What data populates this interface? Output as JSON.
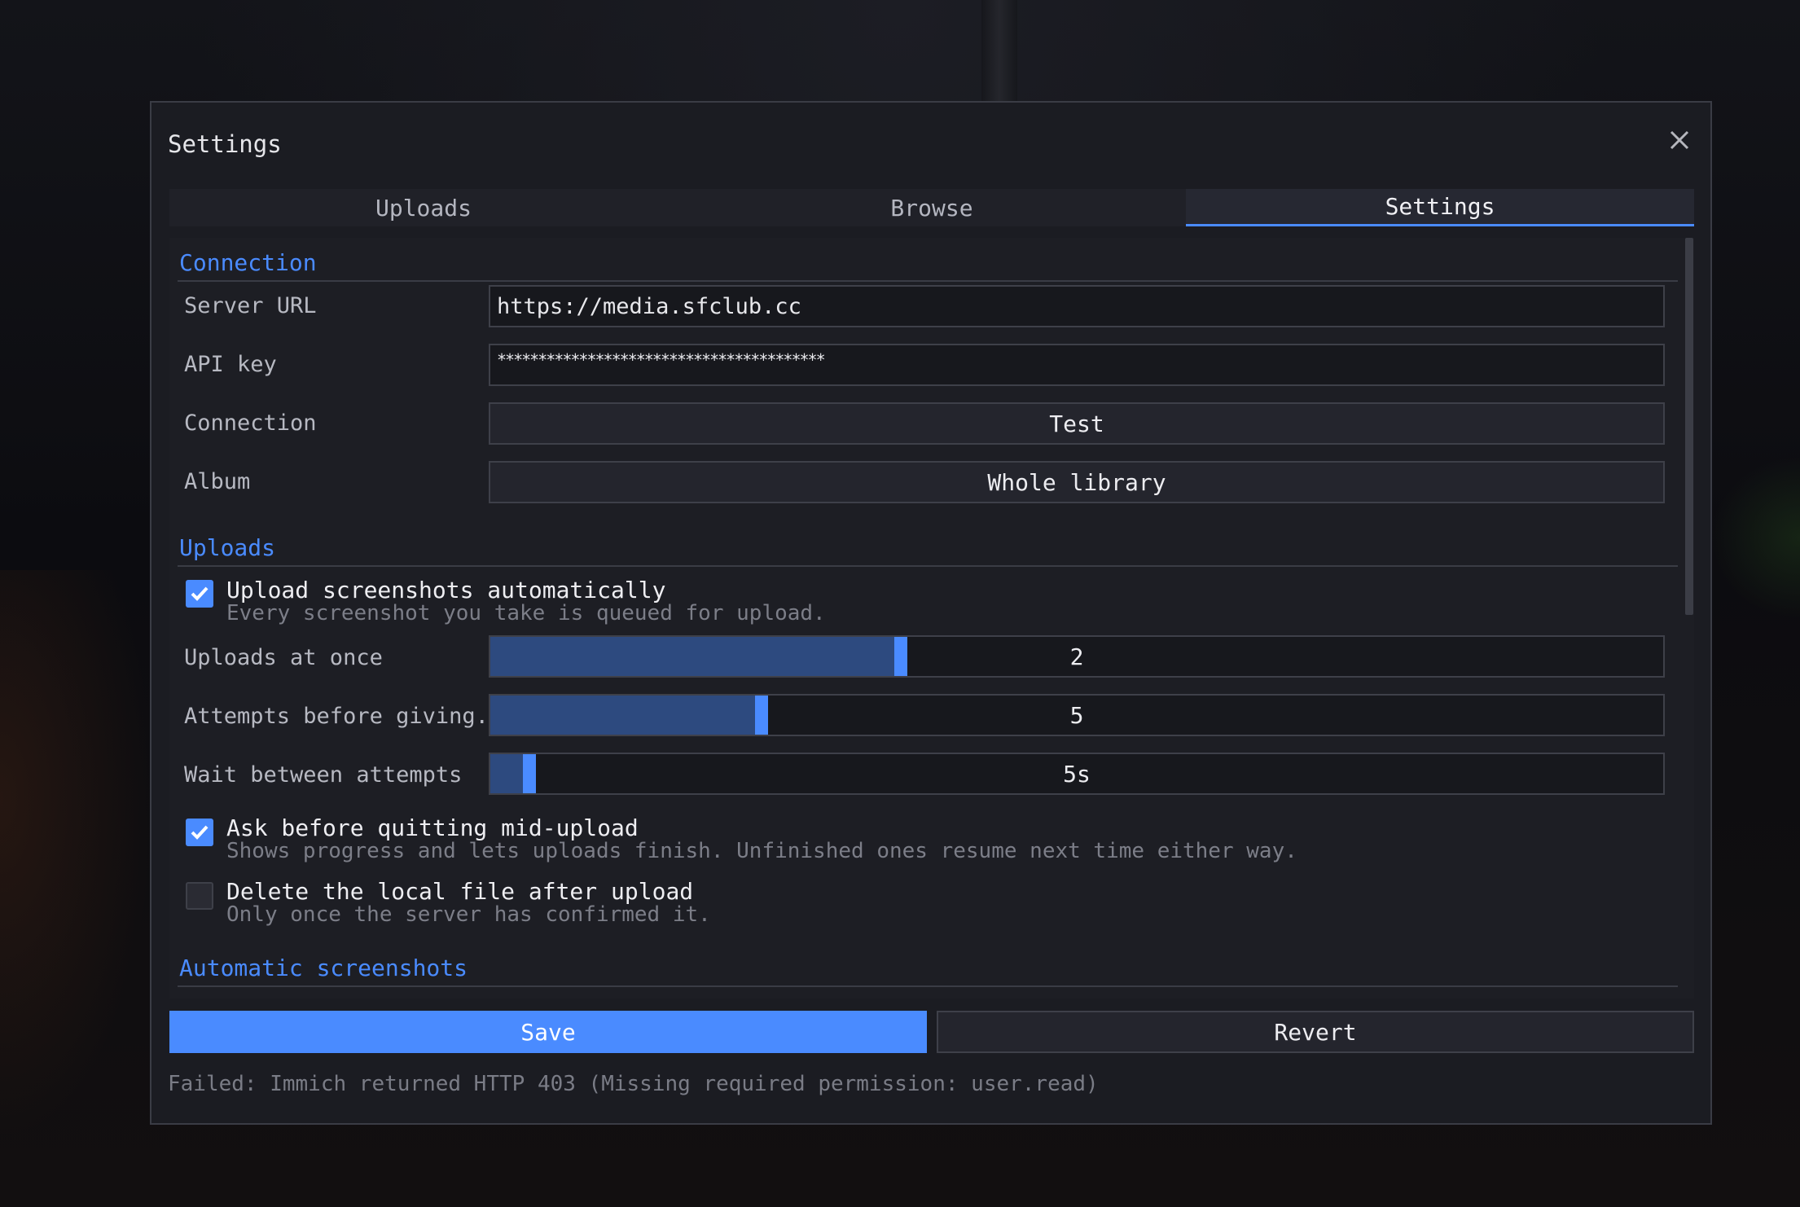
{
  "window": {
    "title": "Settings",
    "close_icon": "close-icon"
  },
  "tabs": [
    {
      "label": "Uploads",
      "active": false
    },
    {
      "label": "Browse",
      "active": false
    },
    {
      "label": "Settings",
      "active": true
    }
  ],
  "sections": {
    "connection": {
      "header": "Connection",
      "server_url": {
        "label": "Server URL",
        "value": "https://media.sfclub.cc"
      },
      "api_key": {
        "label": "API key",
        "value": "****************************************"
      },
      "test": {
        "label": "Connection",
        "button": "Test"
      },
      "album": {
        "label": "Album",
        "button": "Whole library"
      }
    },
    "uploads": {
      "header": "Uploads",
      "auto_upload": {
        "title": "Upload screenshots automatically",
        "desc": "Every screenshot you take is queued for upload.",
        "checked": true
      },
      "uploads_at_once": {
        "label": "Uploads at once",
        "value": "2",
        "fraction": 0.34
      },
      "attempts": {
        "label": "Attempts before giving...",
        "value": "5",
        "fraction": 0.22
      },
      "wait": {
        "label": "Wait between attempts",
        "value": "5s",
        "fraction": 0.02
      },
      "ask_quit": {
        "title": "Ask before quitting mid-upload",
        "desc": "Shows progress and lets uploads finish. Unfinished ones resume next time either way.",
        "checked": true
      },
      "delete_local": {
        "title": "Delete the local file after upload",
        "desc": "Only once the server has confirmed it.",
        "checked": false
      }
    },
    "automatic": {
      "header": "Automatic screenshots"
    }
  },
  "footer": {
    "save": "Save",
    "revert": "Revert",
    "status": "Failed: Immich returned HTTP 403 (Missing required permission: user.read)"
  },
  "colors": {
    "accent": "#4a8bff",
    "slider_fill": "#2d4a7f",
    "background": "#1b1c22"
  }
}
